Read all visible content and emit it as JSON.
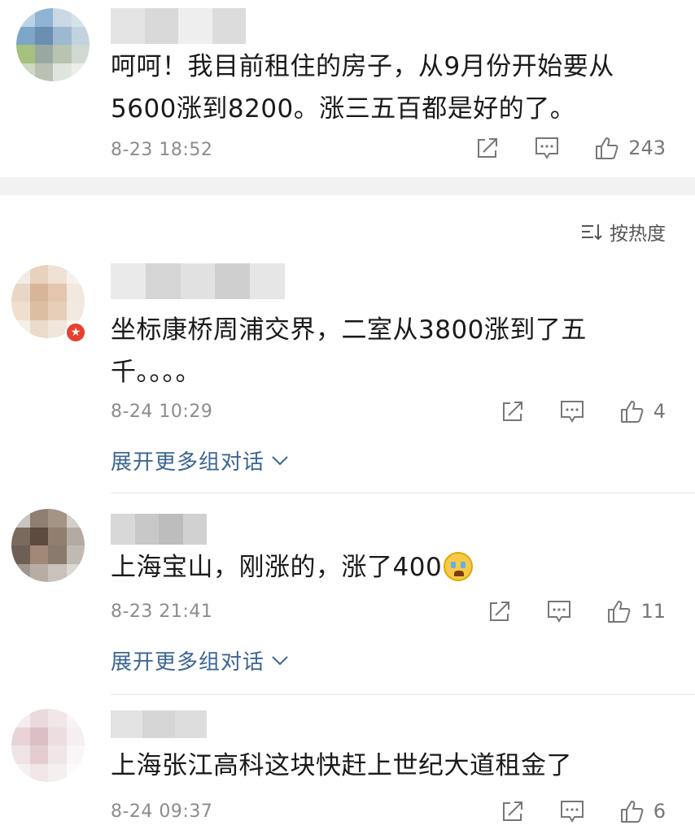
{
  "comments": [
    {
      "text": "呵呵！我目前租住的房子，从9月份开始要从5600涨到8200。涨三五百都是好的了。",
      "text_line1": "呵呵！我目前租住的房子，从9月份开始要从",
      "text_line2": "5600涨到8200。涨三五百都是好的了。",
      "time": "8-23 18:52",
      "likes": "243"
    },
    {
      "text_line1": "坐标康桥周浦交界，二室从3800涨到了五",
      "text_line2": "千。。。。",
      "time": "8-24 10:29",
      "likes": "4",
      "expand_label": "展开更多组对话"
    },
    {
      "text": "上海宝山，刚涨的，涨了400",
      "time": "8-23 21:41",
      "likes": "11",
      "expand_label": "展开更多组对话"
    },
    {
      "text": "上海张江高科这块快赶上世纪大道租金了",
      "time": "8-24 09:37",
      "likes": "6"
    }
  ],
  "sort": {
    "label": "按热度"
  },
  "icons": {
    "share": "share-icon",
    "comment": "comment-icon",
    "like": "thumbs-up-icon",
    "sort": "sort-icon",
    "chevron": "chevron-down-icon",
    "emoji": "crying-emoji-icon",
    "vip": "vip-badge-icon"
  },
  "colors": {
    "link": "#3c6593",
    "meta": "#8c8c8c",
    "band": "#f2f2f2"
  }
}
